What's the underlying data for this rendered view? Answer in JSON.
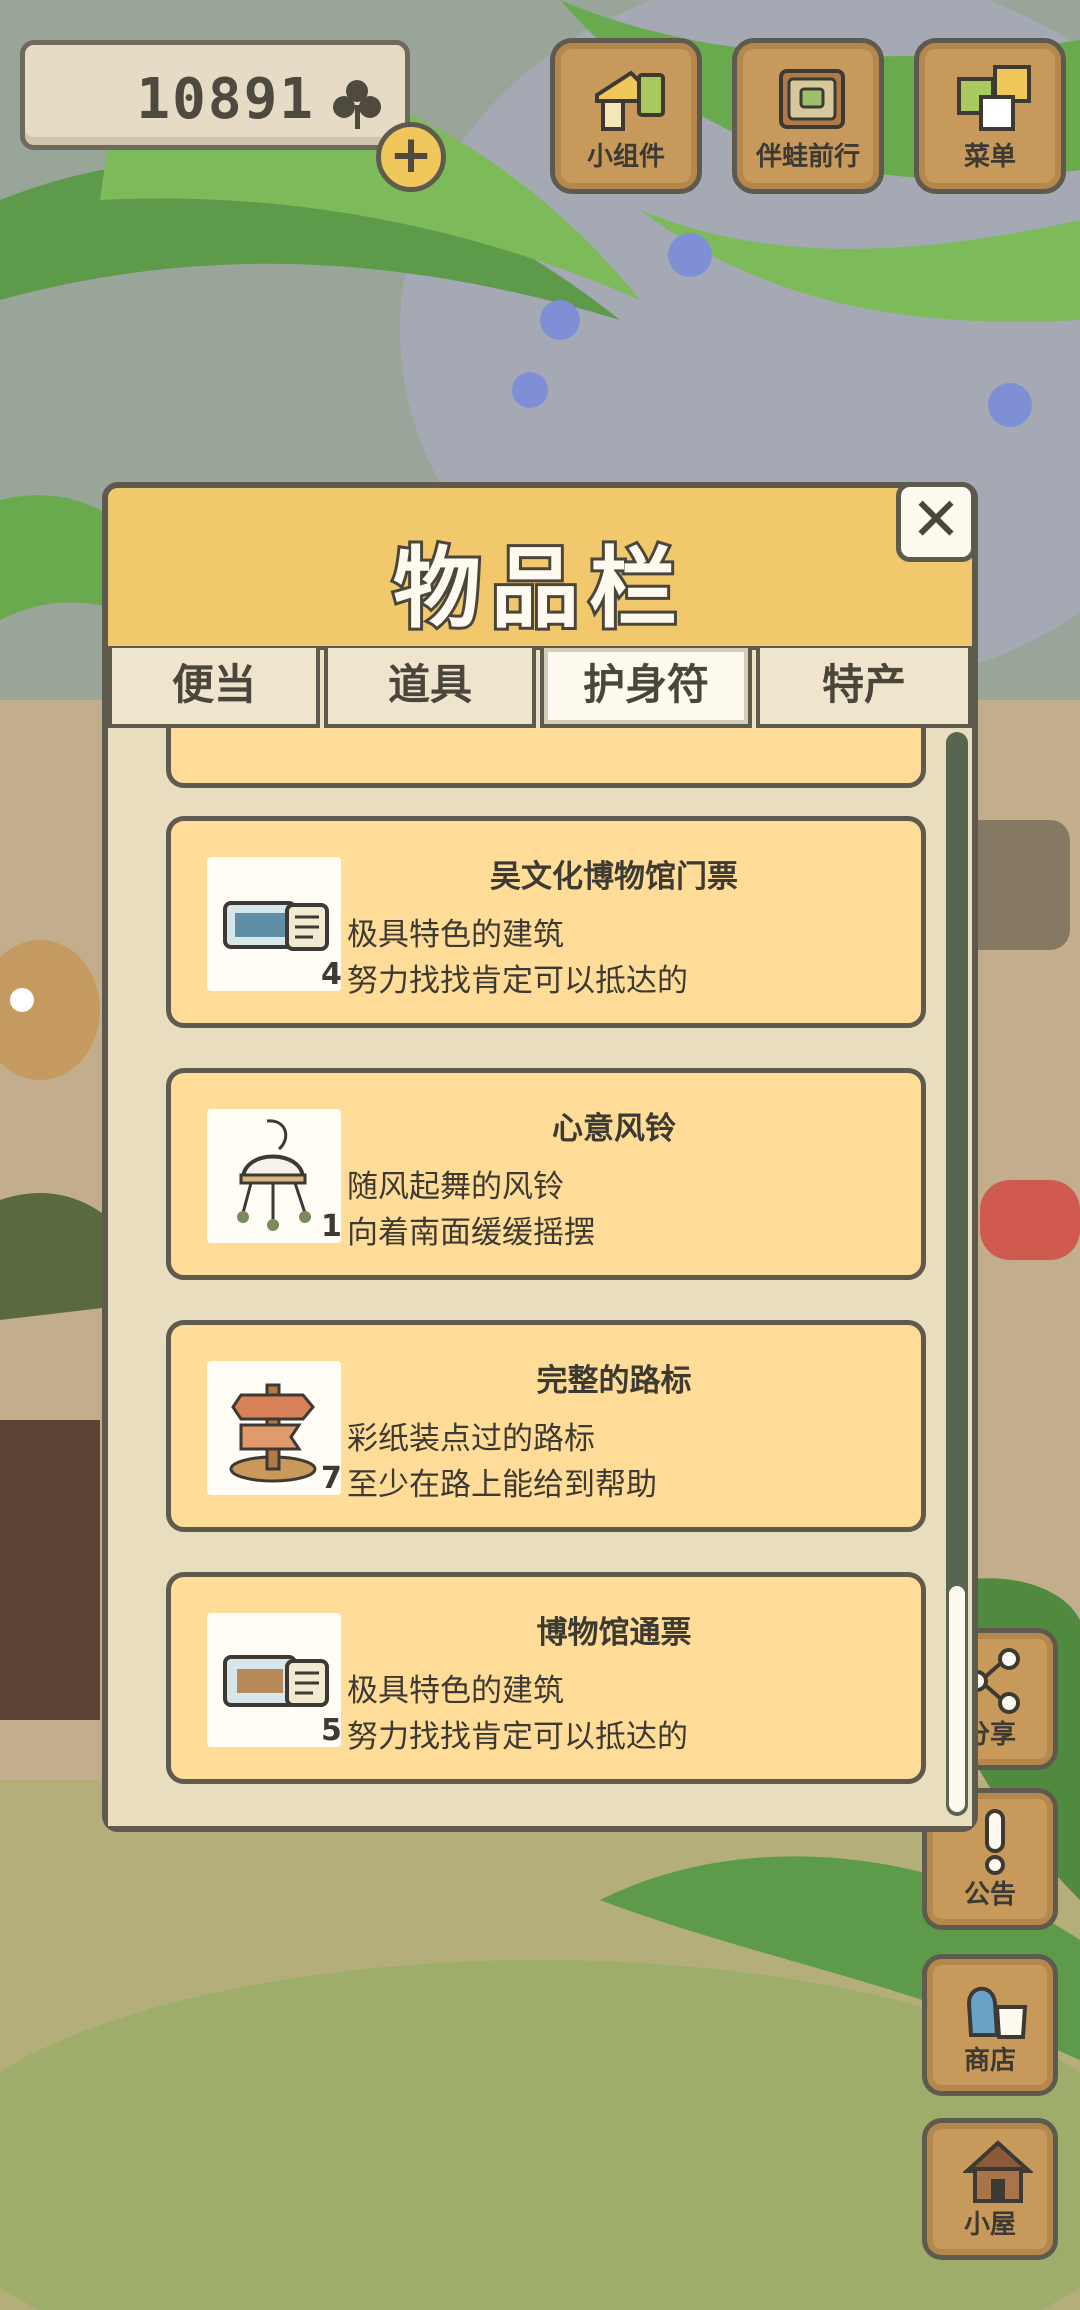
{
  "currency": {
    "count": "10891",
    "icon": "clover-icon",
    "add_icon": "plus-icon"
  },
  "top_buttons": [
    {
      "label": "小组件",
      "icon": "widget-icon"
    },
    {
      "label": "伴蛙前行",
      "icon": "journey-book-icon"
    },
    {
      "label": "菜单",
      "icon": "menu-cards-icon"
    }
  ],
  "modal": {
    "title": "物品栏",
    "close_icon": "close-icon",
    "tabs": [
      "便当",
      "道具",
      "护身符",
      "特产"
    ],
    "active_tab": "护身符",
    "items": [
      {
        "name": "吴文化博物馆门票",
        "qty": "4",
        "desc1": "极具特色的建筑",
        "desc2": "努力找找肯定可以抵达的",
        "icon": "museum-ticket-icon"
      },
      {
        "name": "心意风铃",
        "qty": "1",
        "desc1": "随风起舞的风铃",
        "desc2": "向着南面缓缓摇摆",
        "icon": "wind-chime-icon"
      },
      {
        "name": "完整的路标",
        "qty": "7",
        "desc1": "彩纸装点过的路标",
        "desc2": "至少在路上能给到帮助",
        "icon": "signpost-icon"
      },
      {
        "name": "博物馆通票",
        "qty": "5",
        "desc1": "极具特色的建筑",
        "desc2": "努力找找肯定可以抵达的",
        "icon": "museum-pass-icon"
      }
    ]
  },
  "side_buttons": [
    {
      "label": "分享",
      "icon": "share-icon"
    },
    {
      "label": "公告",
      "icon": "notice-icon"
    },
    {
      "label": "商店",
      "icon": "shop-bag-icon"
    },
    {
      "label": "小屋",
      "icon": "house-icon"
    }
  ],
  "colors": {
    "card": "#ffdd98",
    "header": "#f1c86c",
    "outline": "#5e5a4e",
    "panel": "#ede3c8"
  }
}
